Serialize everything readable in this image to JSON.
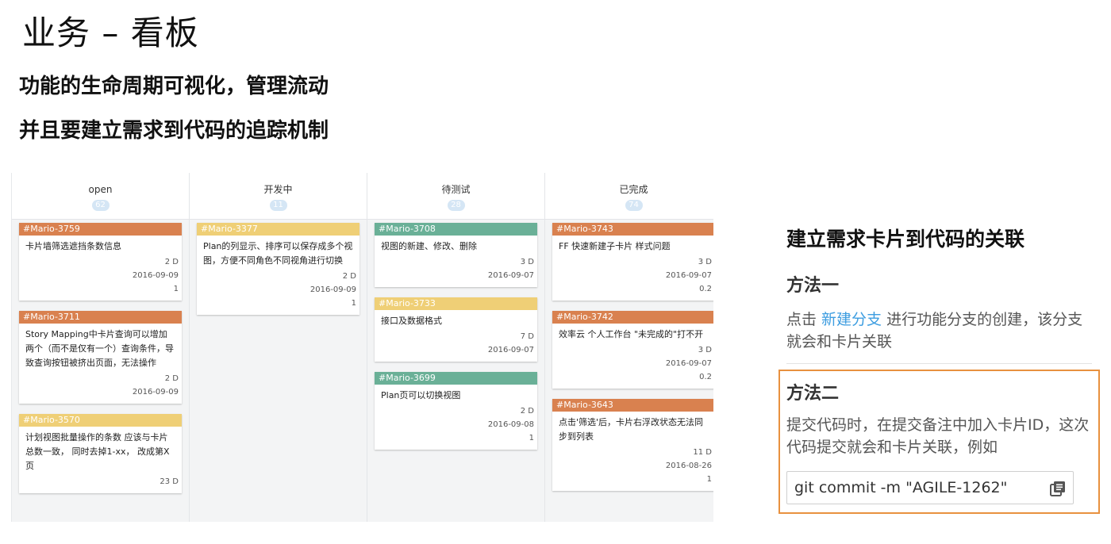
{
  "slide": {
    "title": "业务 – 看板",
    "subtitle1": "功能的生命周期可视化，管理流动",
    "subtitle2": "并且要建立需求到代码的追踪机制"
  },
  "board": {
    "columns": [
      {
        "title": "open",
        "count": "62",
        "cards": [
          {
            "id": "#Mario-3759",
            "color": "orange",
            "title": "卡片墙筛选遮挡条数信息",
            "meta": [
              "2 D",
              "2016-09-09",
              "1"
            ]
          },
          {
            "id": "#Mario-3711",
            "color": "orange",
            "title": "Story Mapping中卡片查询可以增加两个（而不是仅有一个）查询条件，导致查询按钮被挤出页面，无法操作",
            "meta": [
              "2 D",
              "2016-09-09"
            ]
          },
          {
            "id": "#Mario-3570",
            "color": "yellow",
            "title": "计划视图批量操作的条数 应该与卡片总数一致， 同时去掉1-xx， 改成第X页",
            "meta": [
              "23 D"
            ]
          }
        ]
      },
      {
        "title": "开发中",
        "count": "11",
        "cards": [
          {
            "id": "#Mario-3377",
            "color": "yellow",
            "title": "Plan的列显示、排序可以保存成多个视图，方便不同角色不同视角进行切换",
            "meta": [
              "2 D",
              "2016-09-09",
              "1"
            ]
          }
        ]
      },
      {
        "title": "待测试",
        "count": "28",
        "cards": [
          {
            "id": "#Mario-3708",
            "color": "green",
            "title": "视图的新建、修改、删除",
            "meta": [
              "3 D",
              "2016-09-07"
            ]
          },
          {
            "id": "#Mario-3733",
            "color": "yellow",
            "title": "接口及数据格式",
            "meta": [
              "7 D",
              "2016-09-07"
            ]
          },
          {
            "id": "#Mario-3699",
            "color": "green",
            "title": "Plan页可以切换视图",
            "meta": [
              "2 D",
              "2016-09-08",
              "1"
            ]
          }
        ]
      },
      {
        "title": "已完成",
        "count": "74",
        "cards": [
          {
            "id": "#Mario-3743",
            "color": "orange",
            "title": "FF 快速新建子卡片 样式问题",
            "meta": [
              "3 D",
              "2016-09-07",
              "0.2"
            ]
          },
          {
            "id": "#Mario-3742",
            "color": "orange",
            "title": "效率云 个人工作台 \"未完成的\"打不开",
            "meta": [
              "3 D",
              "2016-09-07",
              "0.2"
            ]
          },
          {
            "id": "#Mario-3643",
            "color": "orange",
            "title": "点击'筛选'后，卡片右浮改状态无法同步到列表",
            "meta": [
              "11 D",
              "2016-08-26",
              "1"
            ]
          }
        ]
      }
    ]
  },
  "panel": {
    "title": "建立需求卡片到代码的关联",
    "method1_title": "方法一",
    "method1_prefix": "点击 ",
    "method1_link": "新建分支",
    "method1_suffix": " 进行功能分支的创建，该分支就会和卡片关联",
    "method2_title": "方法二",
    "method2_text": "提交代码时，在提交备注中加入卡片ID，这次代码提交就会和卡片关联，例如",
    "code_value": "git commit -m \"AGILE-1262\"",
    "copy_icon": "copy-icon"
  },
  "colors": {
    "orange": "#d9814f",
    "yellow": "#efcf76",
    "green": "#6ab097",
    "link": "#3d9de0",
    "highlight_border": "#e8913f"
  }
}
